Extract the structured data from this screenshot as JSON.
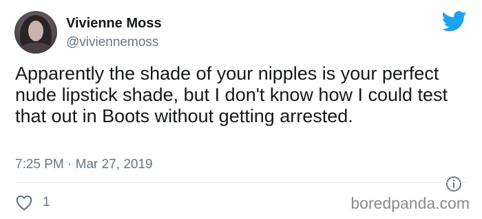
{
  "user": {
    "display_name": "Vivienne Moss",
    "handle": "@viviennemoss"
  },
  "tweet": {
    "text": "Apparently the shade of your nipples is your perfect nude lipstick shade, but I don't know how I could test that out in Boots without getting arrested.",
    "timestamp": "7:25 PM · Mar 27, 2019",
    "like_count": "1"
  },
  "watermark": "boredpanda.com",
  "icons": {
    "brand": "twitter-bird-icon",
    "info": "info-icon",
    "like": "heart-icon"
  },
  "colors": {
    "brand_blue": "#1da1f2",
    "secondary_text": "#657786"
  }
}
